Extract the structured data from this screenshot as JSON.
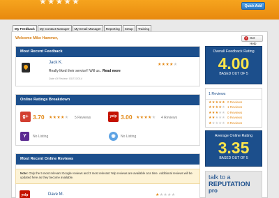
{
  "header": {
    "top_stars": "★★★★★",
    "quick_add_label": "Quick Add"
  },
  "tabs": [
    "My Feedback",
    "My Contact Manager",
    "My Email Manager",
    "Reporting",
    "Setup",
    "Training"
  ],
  "welcome_text": "Welcome Mike Hammer,",
  "get_help_label": "Get Help",
  "most_recent_feedback": {
    "title": "Most Recent Feedback",
    "item": {
      "name": "Jack K.",
      "text": "Really liked their service!! Will us..",
      "read_more": "Read more",
      "date": "Date Of Review: 03/27/2014",
      "rating": 4,
      "icon": "location-pin-icon"
    }
  },
  "online_ratings": {
    "title": "Online Ratings Breakdown",
    "google": {
      "icon": "google-plus-icon",
      "rating": "3.70",
      "stars": 4,
      "reviews": "5 Reviews"
    },
    "yelp": {
      "icon": "yelp-icon",
      "rating": "3.00",
      "stars": 4,
      "reviews": "4 Reviews"
    },
    "yahoo": {
      "icon": "yahoo-icon",
      "text": "No Listing"
    },
    "other": {
      "icon": "globe-icon",
      "text": "No Listing"
    }
  },
  "online_reviews": {
    "title": "Most Recent Online Reviews",
    "note_bold": "Note:",
    "note_text": "Only the 5 most relevant Google reviews and 3 most relevant Yelp reviews are available at a time. Additional reviews will be updated here as they become available.",
    "item": {
      "name": "Dave M.",
      "rating": 1,
      "icon": "yelp-icon"
    }
  },
  "overall_rating": {
    "label": "Overall Feedback Rating",
    "value": "4.00",
    "sub": "BASED OUT OF 5"
  },
  "reviews_breakdown": {
    "total": "1 Reviews",
    "rows": [
      {
        "stars": 5,
        "count": "0 Reviews"
      },
      {
        "stars": 4,
        "count": "1 Reviews"
      },
      {
        "stars": 3,
        "count": "0 Reviews"
      },
      {
        "stars": 2,
        "count": "0 Reviews"
      },
      {
        "stars": 1,
        "count": "0 Reviews"
      }
    ]
  },
  "average_online": {
    "label": "Average Online Rating",
    "value": "3.35",
    "sub": "BASED OUT OF 5"
  },
  "talk": {
    "line1": "talk to a",
    "line2": "REPUTATION",
    "line3": "pro"
  },
  "colors": {
    "brand_orange": "#e8890e",
    "navy": "#1c4f8c",
    "rating_yellow": "#ffe54a"
  }
}
